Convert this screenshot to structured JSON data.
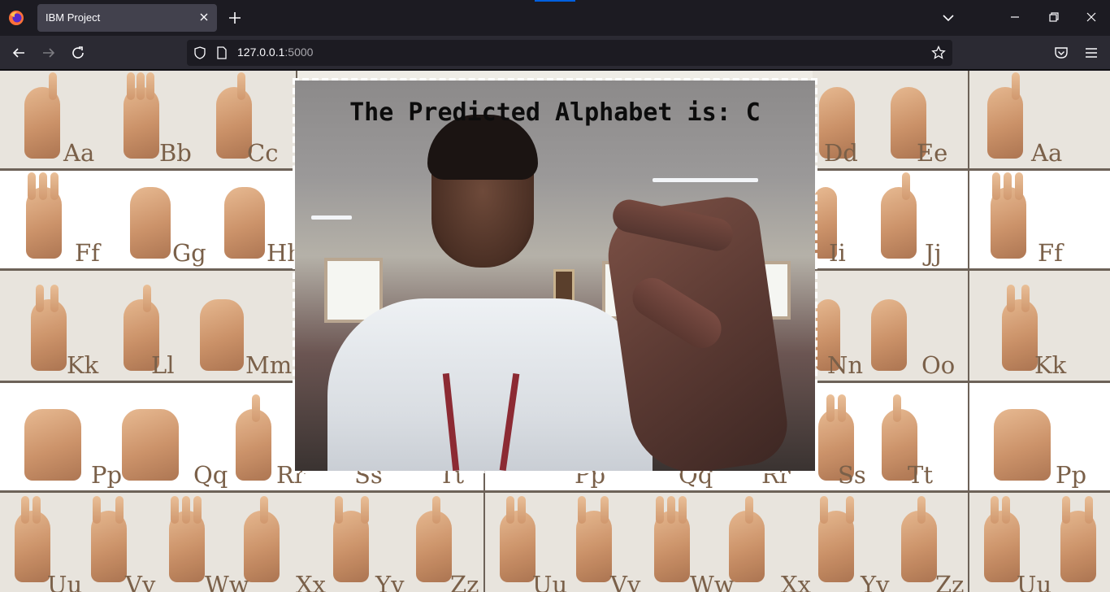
{
  "browser": {
    "tab_title": "IBM Project",
    "url_host": "127.0.0.1",
    "url_port": ":5000"
  },
  "icons": [
    "firefox-logo-icon",
    "tab-close-icon",
    "new-tab-icon",
    "tab-list-icon",
    "minimize-icon",
    "restore-icon",
    "close-icon",
    "back-icon",
    "forward-icon",
    "reload-icon",
    "shield-icon",
    "page-icon",
    "bookmark-star-icon",
    "pocket-icon",
    "menu-icon"
  ],
  "colors": {
    "tab_bg": "#42414d",
    "chrome_bg": "#1c1b22",
    "toolbar_bg": "#2b2a33",
    "accent": "#0060df"
  },
  "asl_chart": {
    "rows": [
      [
        "Aa",
        "Bb",
        "Cc",
        "Dd",
        "Ee",
        "Aa"
      ],
      [
        "Ff",
        "Gg",
        "Hh",
        "Ii",
        "Jj",
        "Ff"
      ],
      [
        "Kk",
        "Ll",
        "Mm",
        "Nn",
        "Oo",
        "Kk"
      ],
      [
        "Pp",
        "Qq",
        "Rr",
        "Ss",
        "Tt",
        "Pp",
        "Qq",
        "Rr",
        "Ss",
        "Tt",
        "Pp"
      ],
      [
        "Uu",
        "Vv",
        "Ww",
        "Xx",
        "Yy",
        "Zz",
        "Uu",
        "Vv",
        "Ww",
        "Xx",
        "Yy",
        "Zz",
        "Uu"
      ]
    ]
  },
  "webcam": {
    "prediction_text": "The Predicted Alphabet is: C"
  }
}
